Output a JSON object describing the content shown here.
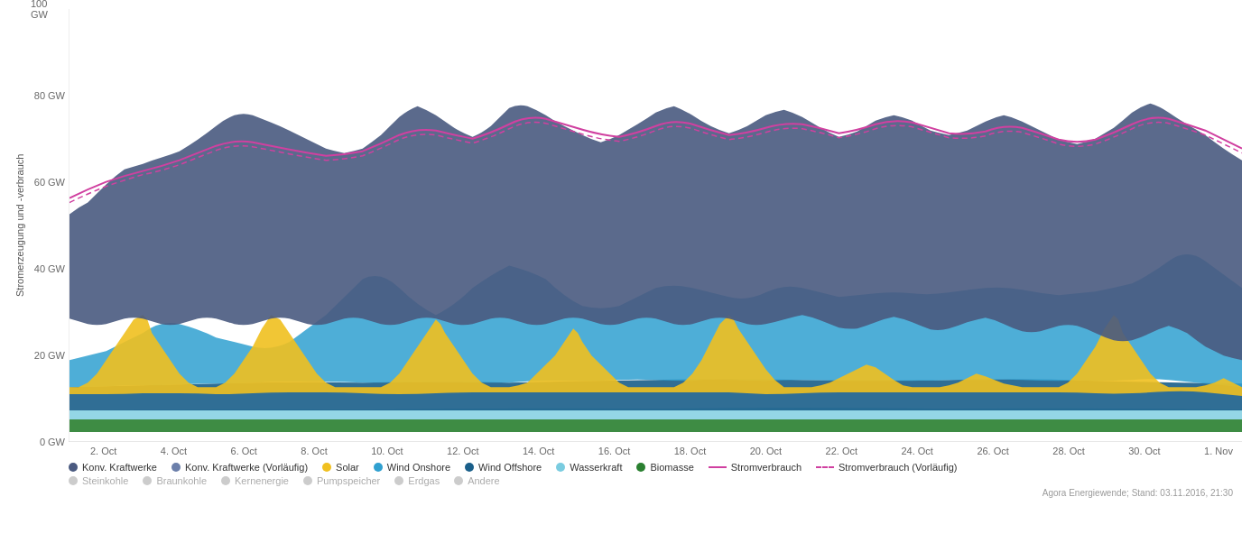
{
  "chart": {
    "title": "Stromerzeugung und -verbrauch",
    "y_axis_label": "Stromerzeugung und -verbrauch",
    "y_ticks": [
      {
        "label": "100 GW",
        "pct": 0
      },
      {
        "label": "80 GW",
        "pct": 20
      },
      {
        "label": "60 GW",
        "pct": 40
      },
      {
        "label": "40 GW",
        "pct": 60
      },
      {
        "label": "20 GW",
        "pct": 80
      },
      {
        "label": "0 GW",
        "pct": 100
      }
    ],
    "x_labels": [
      "2. Oct",
      "4. Oct",
      "6. Oct",
      "8. Oct",
      "10. Oct",
      "12. Oct",
      "14. Oct",
      "16. Oct",
      "18. Oct",
      "20. Oct",
      "22. Oct",
      "24. Oct",
      "26. Oct",
      "28. Oct",
      "30. Oct",
      "1. Nov"
    ],
    "watermark": "Agora Energiewende; Stand: 03.11.2016, 21:30"
  },
  "legend": {
    "items": [
      {
        "label": "Konv. Kraftwerke",
        "type": "dot",
        "color": "#4a5a80"
      },
      {
        "label": "Konv. Kraftwerke (Vorläufig)",
        "type": "dot",
        "color": "#6b7faa"
      },
      {
        "label": "Solar",
        "type": "dot",
        "color": "#f0c020"
      },
      {
        "label": "Wind Onshore",
        "type": "dot",
        "color": "#30a0d0"
      },
      {
        "label": "Wind Offshore",
        "type": "dot",
        "color": "#1a5f8a"
      },
      {
        "label": "Wasserkraft",
        "type": "dot",
        "color": "#7acce0"
      },
      {
        "label": "Biomasse",
        "type": "dot",
        "color": "#2a7a30"
      },
      {
        "label": "Stromverbrauch",
        "type": "line",
        "color": "#d040a0"
      },
      {
        "label": "Stromverbrauch (Vorläufig)",
        "type": "dashed",
        "color": "#d040a0"
      }
    ],
    "items2": [
      {
        "label": "Steinkohle"
      },
      {
        "label": "Braunkohle"
      },
      {
        "label": "Kernenergie"
      },
      {
        "label": "Pumpspeicher"
      },
      {
        "label": "Erdgas"
      },
      {
        "label": "Andere"
      }
    ]
  }
}
